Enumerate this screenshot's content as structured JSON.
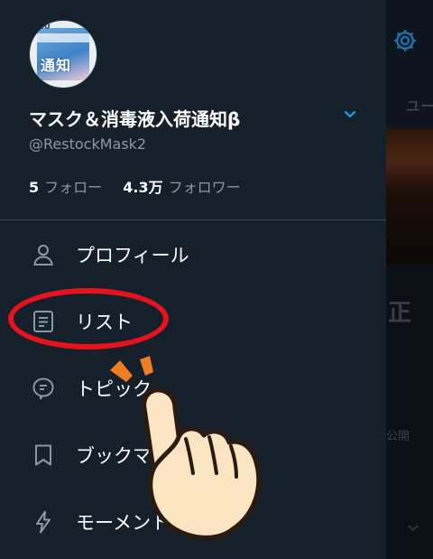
{
  "account": {
    "name": "マスク＆消毒液入荷通知β",
    "handle": "@RestockMask2",
    "avatar_text": "通知",
    "avatar_tag": "50"
  },
  "stats": {
    "following_count": "5",
    "following_label": "フォロー",
    "followers_count": "4.3万",
    "followers_label": "フォロワー"
  },
  "menu": {
    "profile": "プロフィール",
    "lists": "リスト",
    "topics": "トピック",
    "bookmarks": "ブックマ",
    "moments": "モーメント"
  },
  "background": {
    "tab_partial": "ユー",
    "headline_partial": "正",
    "public_partial": "公開"
  },
  "colors": {
    "background": "#15202b",
    "accent": "#1da1f2",
    "secondary_text": "#8899a6",
    "highlight_oval": "#e8121c"
  },
  "icons": {
    "profile": "person-icon",
    "lists": "list-icon",
    "topics": "topic-bubble-icon",
    "bookmarks": "bookmark-icon",
    "moments": "lightning-icon",
    "settings": "gear-icon",
    "account_switch": "chevron-down-icon"
  }
}
